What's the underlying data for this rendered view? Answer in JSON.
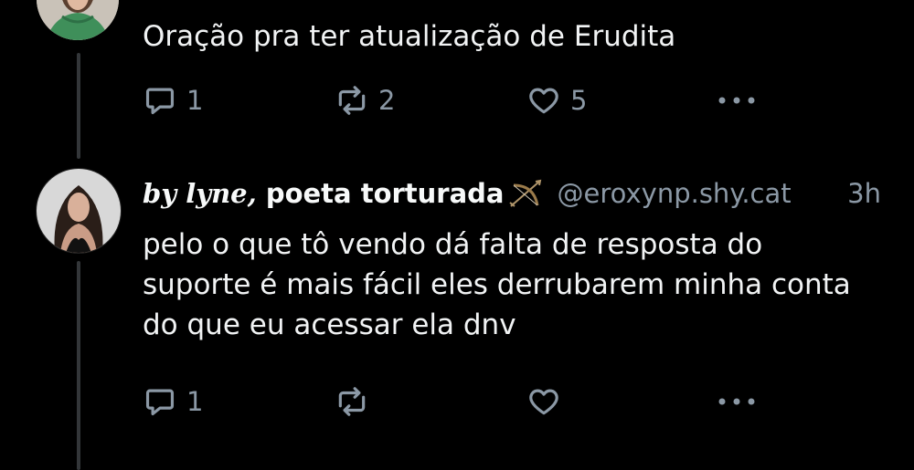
{
  "tweets": [
    {
      "text": "Oração pra ter atualização de Erudita",
      "actions": {
        "reply_count": "1",
        "retweet_count": "2",
        "like_count": "5"
      }
    },
    {
      "author": {
        "name_styled": "by lyne,",
        "name_rest": " poeta torturada",
        "handle": "@eroxynp.shy.cat",
        "time": "3h"
      },
      "text": "pelo o que tô vendo dá falta de resposta do suporte é mais fácil eles derrubarem minha conta do que eu acessar ela dnv",
      "actions": {
        "reply_count": "1",
        "retweet_count": "",
        "like_count": ""
      }
    }
  ],
  "icons": {
    "reply": "reply-icon",
    "retweet": "retweet-icon",
    "like": "heart-icon",
    "more": "more-icon",
    "emoji": "bow-and-arrow-icon"
  },
  "colors": {
    "background": "#000000",
    "text": "#e7e9ea",
    "secondary": "#8b98a5",
    "thread_line": "#333639"
  }
}
